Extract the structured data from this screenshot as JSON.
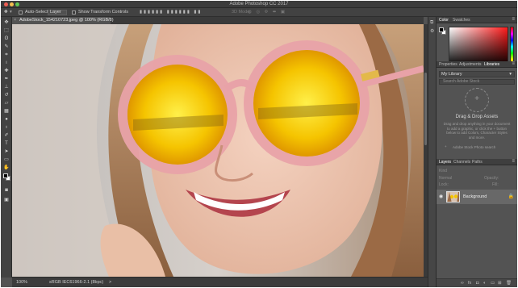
{
  "window": {
    "title": "Adobe Photoshop CC 2017",
    "traffic_colors": {
      "close": "#ee5d52",
      "minimize": "#f4bf4f",
      "zoom": "#61c554"
    }
  },
  "options_bar": {
    "auto_select_label": "Auto-Select:",
    "auto_select_value": "Layer",
    "show_transform_label": "Show Transform Controls",
    "mode_label": "3D Mode:"
  },
  "document_tab": {
    "close_glyph": "×",
    "title": "AdobeStock_154210723.jpeg @ 100% (RGB/8)"
  },
  "status_bar": {
    "zoom": "100%",
    "doc_info": "sRGB IEC61966-2.1 (8bpc)",
    "arrow": ">"
  },
  "color_panel": {
    "tabs": [
      "Color",
      "Swatches"
    ],
    "foreground": "#000000",
    "background": "#ffffff"
  },
  "libraries_panel": {
    "tabs": [
      "Properties",
      "Adjustments",
      "Libraries"
    ],
    "library_name": "My Library",
    "search_placeholder": "Search Adobe Stock",
    "drop_title": "Drag & Drop Assets",
    "drop_description": "Drag and drop anything in your document to add a graphic, or click the + button below to add Colors, Character Styles and more.",
    "footer_text": "Adobe Stock Photo search"
  },
  "layers_panel": {
    "tabs": [
      "Layers",
      "Channels",
      "Paths"
    ],
    "kind_label": "Kind",
    "blend_mode": "Normal",
    "opacity_label": "Opacity:",
    "lock_label": "Lock:",
    "fill_label": "Fill:",
    "layers": [
      {
        "name": "Background",
        "visible": true,
        "locked": true
      }
    ]
  },
  "toolbar": {
    "tools": [
      "move-tool",
      "marquee-tool",
      "lasso-tool",
      "quick-select-tool",
      "crop-tool",
      "eyedropper-tool",
      "healing-brush-tool",
      "brush-tool",
      "clone-stamp-tool",
      "history-brush-tool",
      "eraser-tool",
      "gradient-tool",
      "blur-tool",
      "dodge-tool",
      "pen-tool",
      "type-tool",
      "path-select-tool",
      "rectangle-tool",
      "hand-tool",
      "zoom-tool"
    ]
  }
}
